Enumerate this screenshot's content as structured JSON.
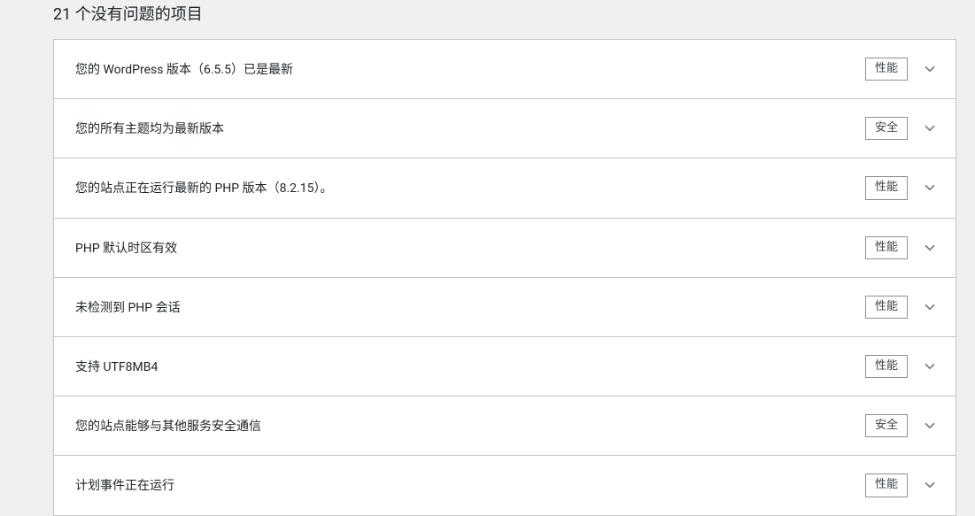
{
  "section": {
    "title": "21 个没有问题的项目"
  },
  "badges": {
    "performance": "性能",
    "security": "安全"
  },
  "issues": [
    {
      "title": "您的 WordPress 版本（6.5.5）已是最新",
      "badge": "performance"
    },
    {
      "title": "您的所有主题均为最新版本",
      "badge": "security"
    },
    {
      "title": "您的站点正在运行最新的 PHP 版本（8.2.15）。",
      "badge": "performance"
    },
    {
      "title": "PHP 默认时区有效",
      "badge": "performance"
    },
    {
      "title": "未检测到 PHP 会话",
      "badge": "performance"
    },
    {
      "title": "支持 UTF8MB4",
      "badge": "performance"
    },
    {
      "title": "您的站点能够与其他服务安全通信",
      "badge": "security"
    },
    {
      "title": "计划事件正在运行",
      "badge": "performance"
    }
  ]
}
